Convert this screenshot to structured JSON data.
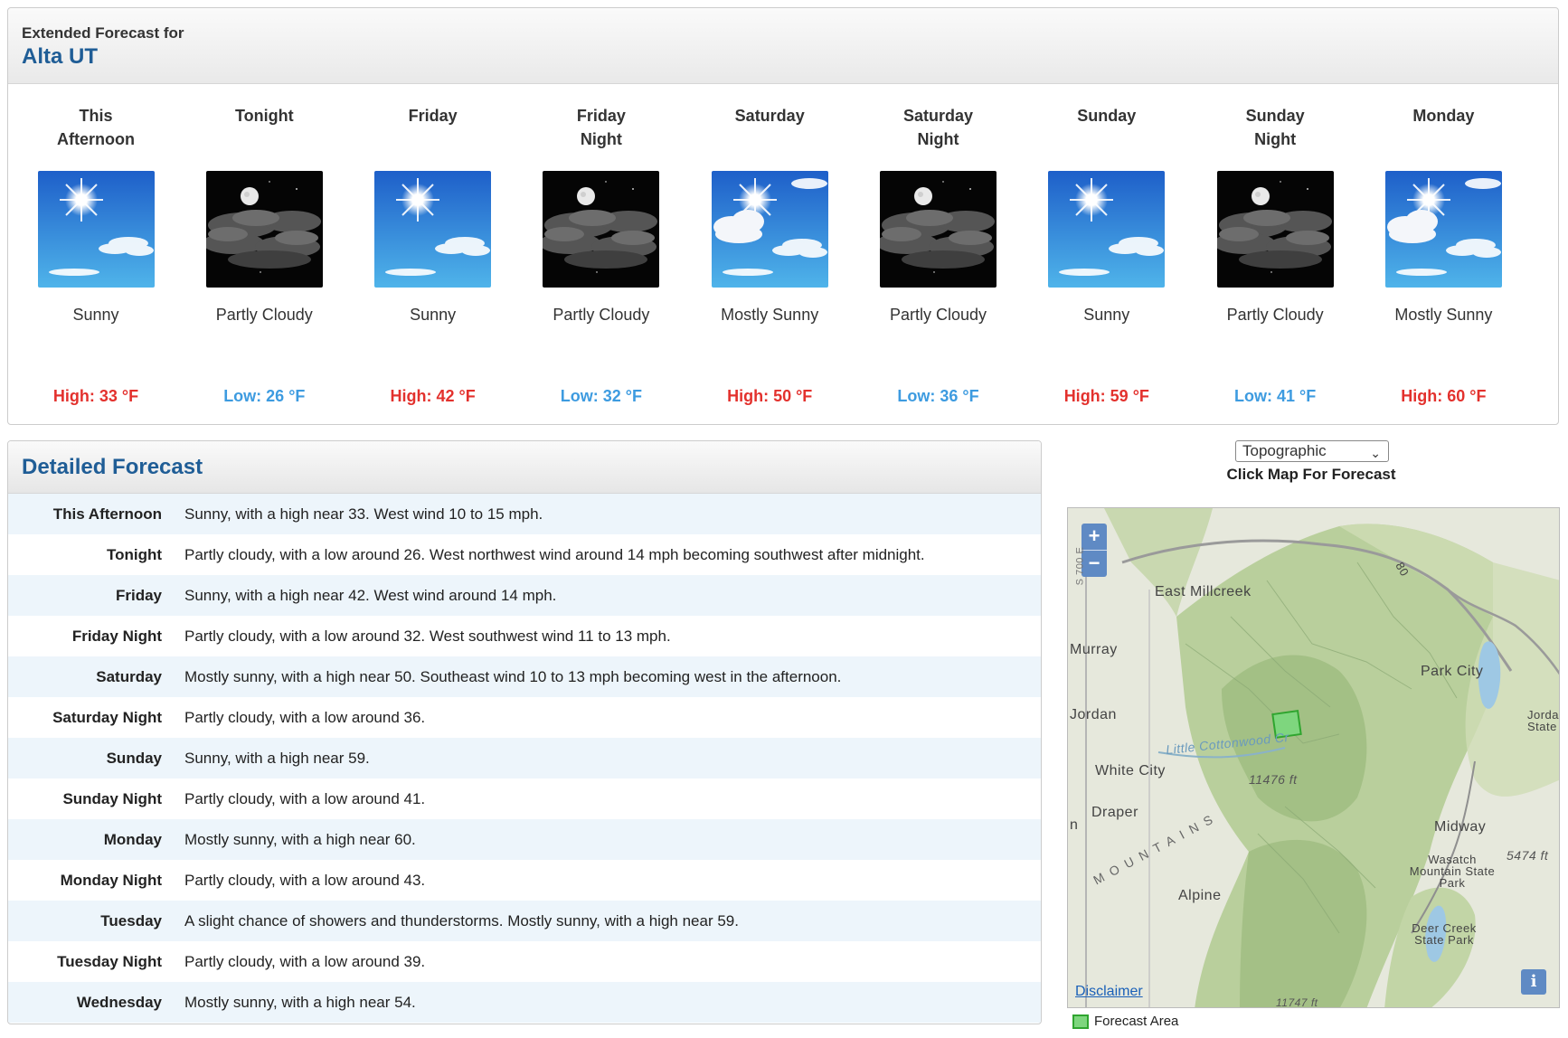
{
  "header": {
    "subtitle": "Extended Forecast for",
    "location": "Alta UT"
  },
  "periods": [
    {
      "name": "This Afternoon",
      "icon": "sunny-icon",
      "cond": "Sunny",
      "temp": "High: 33 °F",
      "kind": "hi"
    },
    {
      "name": "Tonight",
      "icon": "night-partly-cloudy-icon",
      "cond": "Partly Cloudy",
      "temp": "Low: 26 °F",
      "kind": "lo"
    },
    {
      "name": "Friday",
      "icon": "sunny-icon",
      "cond": "Sunny",
      "temp": "High: 42 °F",
      "kind": "hi"
    },
    {
      "name": "Friday Night",
      "icon": "night-partly-cloudy-icon",
      "cond": "Partly Cloudy",
      "temp": "Low: 32 °F",
      "kind": "lo"
    },
    {
      "name": "Saturday",
      "icon": "mostly-sunny-icon",
      "cond": "Mostly Sunny",
      "temp": "High: 50 °F",
      "kind": "hi"
    },
    {
      "name": "Saturday Night",
      "icon": "night-partly-cloudy-icon",
      "cond": "Partly Cloudy",
      "temp": "Low: 36 °F",
      "kind": "lo"
    },
    {
      "name": "Sunday",
      "icon": "sunny-icon",
      "cond": "Sunny",
      "temp": "High: 59 °F",
      "kind": "hi"
    },
    {
      "name": "Sunday Night",
      "icon": "night-partly-cloudy-icon",
      "cond": "Partly Cloudy",
      "temp": "Low: 41 °F",
      "kind": "lo"
    },
    {
      "name": "Monday",
      "icon": "mostly-sunny-icon",
      "cond": "Mostly Sunny",
      "temp": "High: 60 °F",
      "kind": "hi"
    }
  ],
  "detailed": {
    "title": "Detailed Forecast",
    "rows": [
      {
        "label": "This Afternoon",
        "text": "Sunny, with a high near 33. West wind 10 to 15 mph."
      },
      {
        "label": "Tonight",
        "text": "Partly cloudy, with a low around 26. West northwest wind around 14 mph becoming southwest after midnight."
      },
      {
        "label": "Friday",
        "text": "Sunny, with a high near 42. West wind around 14 mph."
      },
      {
        "label": "Friday Night",
        "text": "Partly cloudy, with a low around 32. West southwest wind 11 to 13 mph."
      },
      {
        "label": "Saturday",
        "text": "Mostly sunny, with a high near 50. Southeast wind 10 to 13 mph becoming west in the afternoon."
      },
      {
        "label": "Saturday Night",
        "text": "Partly cloudy, with a low around 36."
      },
      {
        "label": "Sunday",
        "text": "Sunny, with a high near 59."
      },
      {
        "label": "Sunday Night",
        "text": "Partly cloudy, with a low around 41."
      },
      {
        "label": "Monday",
        "text": "Mostly sunny, with a high near 60."
      },
      {
        "label": "Monday Night",
        "text": "Partly cloudy, with a low around 43."
      },
      {
        "label": "Tuesday",
        "text": "A slight chance of showers and thunderstorms. Mostly sunny, with a high near 59."
      },
      {
        "label": "Tuesday Night",
        "text": "Partly cloudy, with a low around 39."
      },
      {
        "label": "Wednesday",
        "text": "Mostly sunny, with a high near 54."
      }
    ]
  },
  "map": {
    "select_value": "Topographic",
    "caption": "Click Map For Forecast",
    "zoom_in": "+",
    "zoom_out": "−",
    "info": "i",
    "disclaimer": "Disclaimer",
    "legend": "Forecast Area",
    "labels": [
      "East Millcreek",
      "Murray",
      "Park City",
      "Jordan",
      "White City",
      "Draper",
      "Midway",
      "Alpine",
      "Wasatch Mountain State Park",
      "Deer Creek State Park",
      "11476 ft",
      "5474 ft",
      "Little Cottonwood Cr",
      "80",
      "Jorda State",
      "MOUNTAINS",
      "S 700 E",
      "n",
      "11747 ft"
    ]
  },
  "colors": {
    "high": "#e3312d",
    "low": "#3d9be0",
    "heading": "#1f5d96",
    "forecast_area": "#7ed67e"
  }
}
